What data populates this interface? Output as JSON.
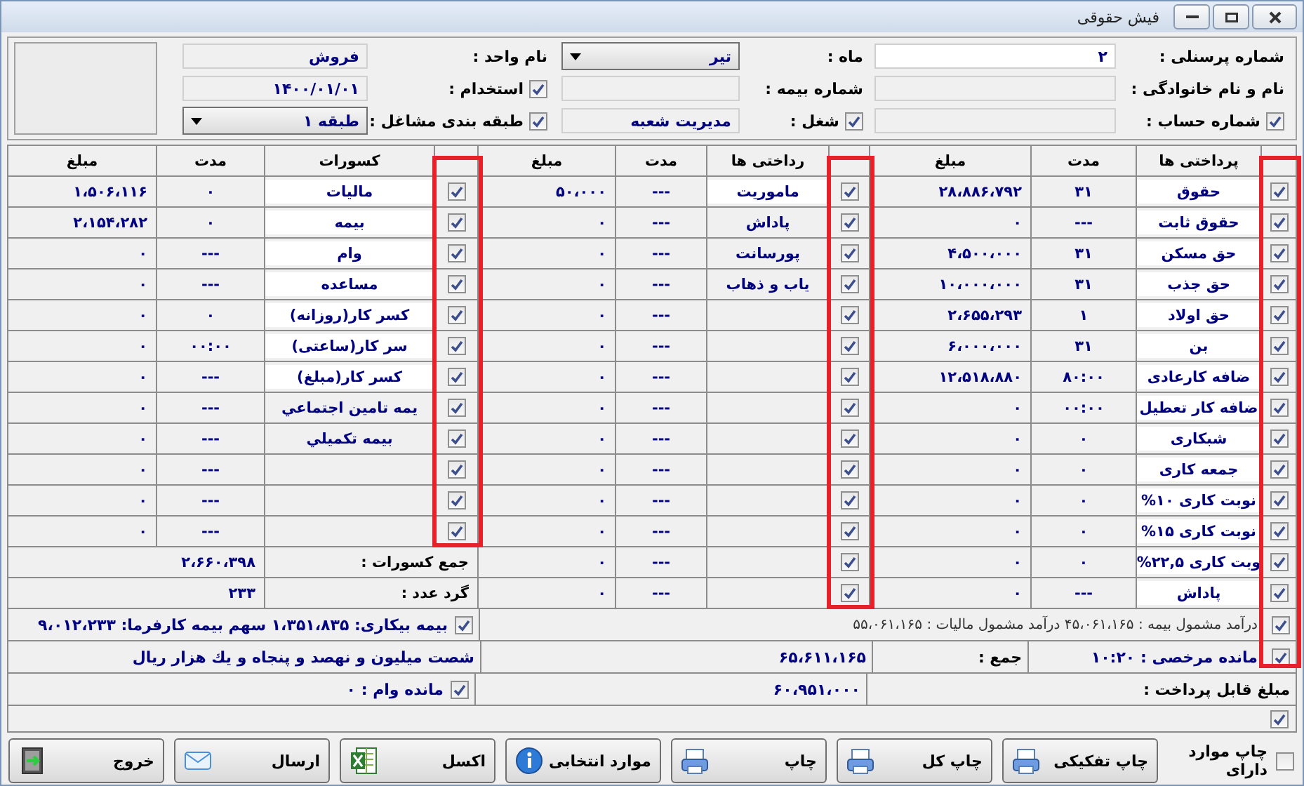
{
  "window": {
    "title": "فیش حقوقی"
  },
  "header": {
    "fields": [
      {
        "label": "شماره پرسنلی :",
        "kind": "text",
        "value": "۲"
      },
      {
        "label": "ماه :",
        "kind": "dropdown",
        "value": "تیر"
      },
      {
        "label": "نام واحد :",
        "kind": "readonly",
        "value": "فروش"
      },
      {
        "label": "نام و نام خانوادگی :",
        "kind": "readonly"
      },
      {
        "label": "شماره بیمه :",
        "kind": "readonly"
      },
      {
        "label": "استخدام :",
        "kind": "readonly",
        "value": "۱۴۰۰/۰۱/۰۱",
        "checked": true
      },
      {
        "label": "شماره حساب :",
        "kind": "readonly",
        "checked": true
      },
      {
        "label": "شغل :",
        "kind": "readonly",
        "value": "مدیریت شعبه",
        "checked": true
      },
      {
        "label": "طبقه بندی مشاغل :",
        "kind": "dropdown",
        "value": "طبقه ۱",
        "checked": true
      }
    ]
  },
  "earnings": {
    "highlight": true,
    "columns": [
      "پرداختی ها",
      "مدت",
      "مبلغ"
    ],
    "rows": [
      {
        "checked": true,
        "boxed": true,
        "name": "حقوق",
        "duration": "۳۱",
        "amount": "۲۸،۸۸۶،۷۹۲"
      },
      {
        "checked": true,
        "boxed": true,
        "name": "حقوق ثابت",
        "duration": "---",
        "amount": "۰"
      },
      {
        "checked": true,
        "boxed": true,
        "name": "حق مسکن",
        "duration": "۳۱",
        "amount": "۴،۵۰۰،۰۰۰"
      },
      {
        "checked": true,
        "boxed": true,
        "name": "حق جذب",
        "duration": "۳۱",
        "amount": "۱۰،۰۰۰،۰۰۰"
      },
      {
        "checked": true,
        "boxed": true,
        "name": "حق اولاد",
        "duration": "۱",
        "amount": "۲،۶۵۵،۲۹۳"
      },
      {
        "checked": true,
        "boxed": true,
        "name": "بن",
        "duration": "۳۱",
        "amount": "۶،۰۰۰،۰۰۰"
      },
      {
        "checked": true,
        "boxed": true,
        "name": "ضافه کارعادی",
        "duration": "۸۰:۰۰",
        "amount": "۱۲،۵۱۸،۸۸۰"
      },
      {
        "checked": true,
        "boxed": true,
        "name": "ضافه کار تعطیل",
        "duration": "۰۰:۰۰",
        "amount": "۰"
      },
      {
        "checked": true,
        "boxed": true,
        "name": "شبکاری",
        "duration": "۰",
        "amount": "۰"
      },
      {
        "checked": true,
        "boxed": true,
        "name": "جمعه کاری",
        "duration": "۰",
        "amount": "۰"
      },
      {
        "checked": true,
        "boxed": true,
        "name": "نوبت کاری ۱۰%",
        "duration": "۰",
        "amount": "۰"
      },
      {
        "checked": true,
        "boxed": true,
        "name": "نوبت کاری ۱۵%",
        "duration": "۰",
        "amount": "۰"
      },
      {
        "checked": true,
        "boxed": true,
        "name": "وبت کاری ۲۲,۵%",
        "duration": "۰",
        "amount": "۰"
      },
      {
        "checked": true,
        "boxed": true,
        "name": "پاداش",
        "duration": "---",
        "amount": "۰"
      }
    ]
  },
  "other_payments": {
    "highlight": true,
    "columns": [
      "رداختی ها",
      "مدت",
      "مبلغ"
    ],
    "rows": [
      {
        "checked": true,
        "boxed": true,
        "name": "ماموریت",
        "duration": "---",
        "amount": "۵۰،۰۰۰"
      },
      {
        "checked": true,
        "boxed": false,
        "name": "پاداش",
        "duration": "---",
        "amount": "۰"
      },
      {
        "checked": true,
        "boxed": false,
        "name": "پورسانت",
        "duration": "---",
        "amount": "۰"
      },
      {
        "checked": true,
        "boxed": false,
        "name": "یاب و ذهاب",
        "duration": "---",
        "amount": "۰"
      },
      {
        "checked": true,
        "duration": "---",
        "amount": "۰"
      },
      {
        "checked": true,
        "duration": "---",
        "amount": "۰"
      },
      {
        "checked": true,
        "duration": "---",
        "amount": "۰"
      },
      {
        "checked": true,
        "duration": "---",
        "amount": "۰"
      },
      {
        "checked": true,
        "duration": "---",
        "amount": "۰"
      },
      {
        "checked": true,
        "duration": "---",
        "amount": "۰"
      },
      {
        "checked": true,
        "duration": "---",
        "amount": "۰"
      },
      {
        "checked": true,
        "duration": "---",
        "amount": "۰"
      },
      {
        "checked": true,
        "duration": "---",
        "amount": "۰"
      },
      {
        "checked": true,
        "duration": "---",
        "amount": "۰"
      }
    ]
  },
  "deductions": {
    "highlight": true,
    "columns": [
      "کسورات",
      "مدت",
      "مبلغ"
    ],
    "rows": [
      {
        "checked": true,
        "boxed": true,
        "name": "مالیات",
        "duration": "۰",
        "amount": "۱،۵۰۶،۱۱۶"
      },
      {
        "checked": true,
        "boxed": true,
        "name": "بیمه",
        "duration": "۰",
        "amount": "۲،۱۵۴،۲۸۲"
      },
      {
        "checked": true,
        "boxed": true,
        "name": "وام",
        "duration": "---",
        "amount": "۰"
      },
      {
        "checked": true,
        "boxed": true,
        "name": "مساعده",
        "duration": "---",
        "amount": "۰"
      },
      {
        "checked": true,
        "boxed": true,
        "name": "کسر کار(روزانه)",
        "duration": "۰",
        "amount": "۰"
      },
      {
        "checked": true,
        "boxed": true,
        "name": "سر کار(ساعتی)",
        "duration": "۰۰:۰۰",
        "amount": "۰"
      },
      {
        "checked": true,
        "boxed": true,
        "name": "کسر کار(مبلغ)",
        "duration": "---",
        "amount": "۰"
      },
      {
        "checked": true,
        "boxed": false,
        "name": "یمه تامین اجتماعي",
        "duration": "---",
        "amount": "۰"
      },
      {
        "checked": true,
        "boxed": false,
        "name": "بیمه تکمیلي",
        "duration": "---",
        "amount": "۰"
      },
      {
        "checked": true,
        "duration": "---",
        "amount": "۰"
      },
      {
        "checked": true,
        "duration": "---",
        "amount": "۰"
      },
      {
        "checked": true,
        "duration": "---",
        "amount": "۰"
      }
    ],
    "totals": [
      {
        "label": "جمع کسورات :",
        "value": "۲،۶۶۰،۳۹۸"
      },
      {
        "label": "گرد عدد :",
        "value": "۲۳۳"
      }
    ]
  },
  "summary": {
    "taxable": {
      "checked": true,
      "text": "درآمد مشمول بیمه : ۴۵،۰۶۱،۱۶۵ درآمد مشمول مالیات : ۵۵،۰۶۱،۱۶۵"
    },
    "unemployment": {
      "checked": true,
      "text": "بیمه بیکاری: ۱،۳۵۱،۸۳۵ سهم بیمه کارفرما: ۹،۰۱۲،۲۳۳"
    },
    "leave": {
      "checked": true,
      "text": "مانده مرخصی : ۱۰:۲۰"
    },
    "total": {
      "label": "جمع :",
      "value": "۶۵،۶۱۱،۱۶۵"
    },
    "amount_in_words": "شصت میلیون و نهصد و پنجاه و یك هزار ریال",
    "payable": {
      "label": "مبلغ قابل پرداخت :",
      "value": "۶۰،۹۵۱،۰۰۰"
    },
    "loan": {
      "checked": true,
      "text": "مانده وام : ۰"
    },
    "extra": {
      "checked": true
    }
  },
  "print_filter": {
    "checked": false,
    "label": "چاپ موارد دارای"
  },
  "buttons": [
    {
      "label": "چاپ تفکیکی",
      "kind": "print"
    },
    {
      "label": "چاپ کل",
      "kind": "print"
    },
    {
      "label": "چاپ",
      "kind": "print"
    },
    {
      "label": "موارد انتخابی",
      "kind": "info"
    },
    {
      "label": "اکسل",
      "kind": "excel"
    },
    {
      "label": "ارسال",
      "kind": "mail"
    },
    {
      "label": "خروج",
      "kind": "exit"
    }
  ]
}
